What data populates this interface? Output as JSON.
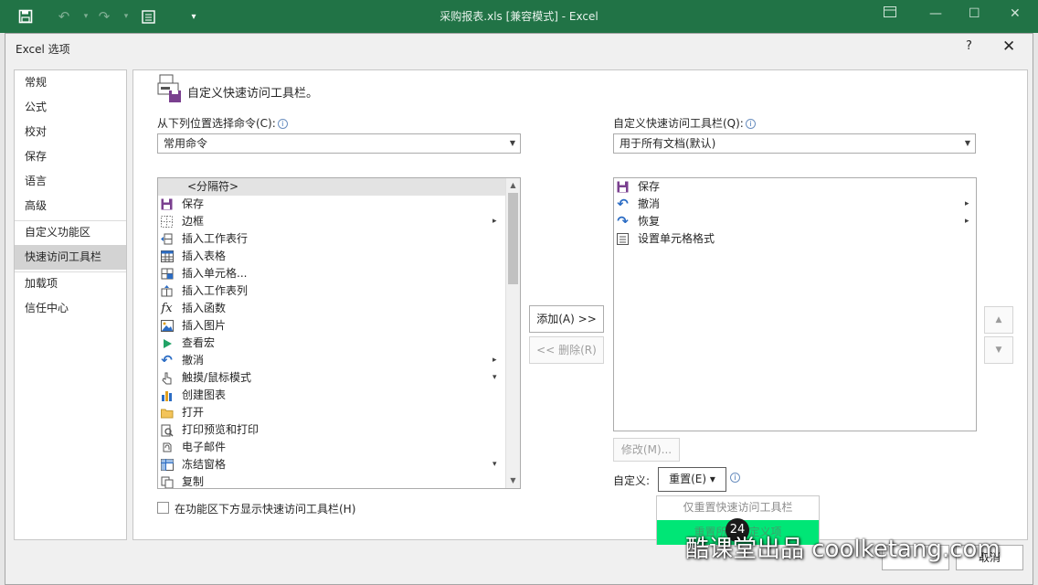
{
  "app": {
    "window_title": "采购报表.xls  [兼容模式] - Excel"
  },
  "dialog": {
    "title": "Excel 选项",
    "help": "?",
    "close": "✕"
  },
  "nav": {
    "items": [
      {
        "label": "常规"
      },
      {
        "label": "公式"
      },
      {
        "label": "校对"
      },
      {
        "label": "保存"
      },
      {
        "label": "语言"
      },
      {
        "label": "高级"
      },
      {
        "label": "自定义功能区"
      },
      {
        "label": "快速访问工具栏",
        "active": true
      },
      {
        "label": "加载项"
      },
      {
        "label": "信任中心"
      }
    ]
  },
  "main": {
    "heading": "自定义快速访问工具栏。",
    "choose_from": {
      "label": "从下列位置选择命令(C):",
      "value": "常用命令"
    },
    "customize_for": {
      "label": "自定义快速访问工具栏(Q):",
      "value": "用于所有文档(默认)"
    },
    "commands": [
      {
        "label": "<分隔符>",
        "icon": "separator",
        "highlighted": true
      },
      {
        "label": "保存",
        "icon": "save-icon"
      },
      {
        "label": "边框",
        "icon": "border-icon",
        "submenu": "▸"
      },
      {
        "label": "插入工作表行",
        "icon": "insert-row-icon"
      },
      {
        "label": "插入表格",
        "icon": "table-icon"
      },
      {
        "label": "插入单元格...",
        "icon": "insert-cell-icon"
      },
      {
        "label": "插入工作表列",
        "icon": "insert-column-icon"
      },
      {
        "label": "插入函数",
        "icon": "function-icon"
      },
      {
        "label": "插入图片",
        "icon": "picture-icon"
      },
      {
        "label": "查看宏",
        "icon": "macro-play-icon"
      },
      {
        "label": "撤消",
        "icon": "undo-icon",
        "submenu": "▸"
      },
      {
        "label": "触摸/鼠标模式",
        "icon": "touch-icon",
        "submenu": "▾"
      },
      {
        "label": "创建图表",
        "icon": "chart-icon"
      },
      {
        "label": "打开",
        "icon": "folder-icon"
      },
      {
        "label": "打印预览和打印",
        "icon": "print-preview-icon"
      },
      {
        "label": "电子邮件",
        "icon": "email-icon"
      },
      {
        "label": "冻结窗格",
        "icon": "freeze-panes-icon",
        "submenu": "▾"
      },
      {
        "label": "复制",
        "icon": "copy-icon"
      }
    ],
    "qat_items": [
      {
        "label": "保存",
        "icon": "save-icon"
      },
      {
        "label": "撤消",
        "icon": "undo-icon",
        "submenu": "▸"
      },
      {
        "label": "恢复",
        "icon": "redo-icon",
        "submenu": "▸"
      },
      {
        "label": "设置单元格格式",
        "icon": "format-cells-icon"
      }
    ],
    "add_button": "添加(A) >>",
    "remove_button": "<< 删除(R)",
    "modify_button": "修改(M)...",
    "customize_label": "自定义:",
    "reset_button": "重置(E) ▾",
    "reset_menu": {
      "item1": "仅重置快速访问工具栏",
      "item2": "重置所有自定义项"
    },
    "show_below": "在功能区下方显示快速访问工具栏(H)",
    "move_up": "▲",
    "move_down": "▼"
  },
  "footer": {
    "cancel": "取消"
  },
  "overlay": {
    "badge": "24",
    "watermark": "酷课堂出品 coolketang.com"
  },
  "colors": {
    "excel_green": "#217346",
    "highlight_green": "#00e676",
    "selected_nav": "#d3d3d3"
  }
}
